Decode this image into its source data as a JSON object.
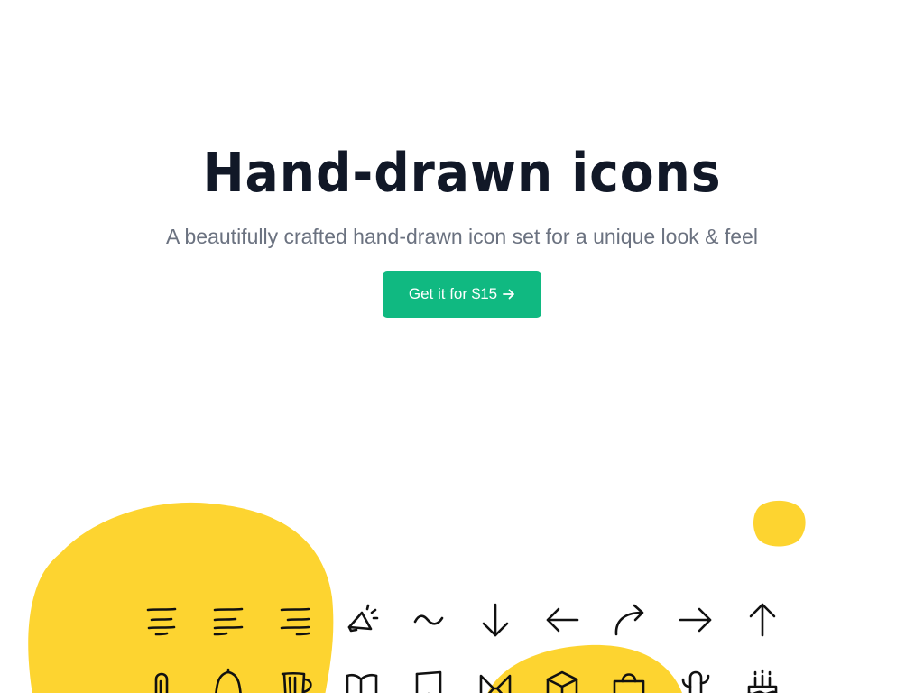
{
  "hero": {
    "title": "Hand-drawn icons",
    "subtitle": "A beautifully crafted hand-drawn icon set for a unique look & feel",
    "cta_label": "Get it for $15"
  },
  "colors": {
    "accent": "#10b981",
    "blob": "#fdd430",
    "title": "#111827",
    "subtitle": "#6b7280"
  },
  "icons": {
    "row1": [
      "align-center-icon",
      "align-left-icon",
      "align-right-icon",
      "announcement-icon",
      "tilde-wave-icon",
      "arrow-down-icon",
      "arrow-left-icon",
      "arrow-curved-right-icon",
      "arrow-right-icon",
      "arrow-up-icon"
    ],
    "row2": [
      "paperclip-icon",
      "bell-icon",
      "beer-mug-icon",
      "open-book-icon",
      "bookmark-icon",
      "bow-tie-icon",
      "box-icon",
      "shopping-bag-icon",
      "cactus-icon",
      "birthday-cake-icon"
    ]
  }
}
